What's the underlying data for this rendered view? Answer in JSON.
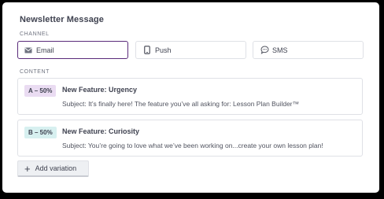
{
  "card": {
    "title": "Newsletter Message"
  },
  "channel": {
    "label": "CHANNEL",
    "options": [
      {
        "label": "Email",
        "icon": "mail-icon",
        "selected": true
      },
      {
        "label": "Push",
        "icon": "mobile-icon",
        "selected": false
      },
      {
        "label": "SMS",
        "icon": "chat-bubble-icon",
        "selected": false
      }
    ],
    "selected_color": "#5a2a7a"
  },
  "content": {
    "label": "CONTENT",
    "variations": [
      {
        "badge": "A – 50%",
        "badge_color": "#eadcf2",
        "name": "New Feature: Urgency",
        "subject": "Subject: It’s finally here! The feature you’ve all asking for: Lesson Plan Builder™"
      },
      {
        "badge": "B – 50%",
        "badge_color": "#d7f0f0",
        "name": "New Feature: Curiosity",
        "subject": "Subject: You’re going to love what we’ve been working on...create your own lesson plan!"
      }
    ],
    "add_label": "Add variation",
    "add_icon": "plus-icon"
  }
}
